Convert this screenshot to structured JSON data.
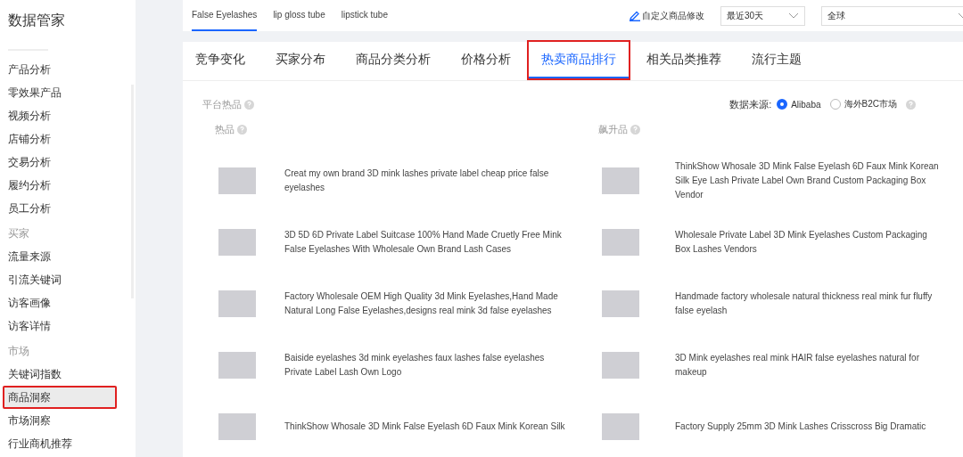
{
  "sidebar": {
    "title": "数据管家",
    "items": [
      {
        "label": "产品分析",
        "kind": "item",
        "selected": false,
        "annotated": false
      },
      {
        "label": "零效果产品",
        "kind": "item",
        "selected": false,
        "annotated": false
      },
      {
        "label": "视频分析",
        "kind": "item",
        "selected": false,
        "annotated": false
      },
      {
        "label": "店铺分析",
        "kind": "item",
        "selected": false,
        "annotated": false
      },
      {
        "label": "交易分析",
        "kind": "item",
        "selected": false,
        "annotated": false
      },
      {
        "label": "履约分析",
        "kind": "item",
        "selected": false,
        "annotated": false
      },
      {
        "label": "员工分析",
        "kind": "item",
        "selected": false,
        "annotated": false
      },
      {
        "label": "买家",
        "kind": "header"
      },
      {
        "label": "流量来源",
        "kind": "item",
        "selected": false,
        "annotated": false
      },
      {
        "label": "引流关键词",
        "kind": "item",
        "selected": false,
        "annotated": false
      },
      {
        "label": "访客画像",
        "kind": "item",
        "selected": false,
        "annotated": false
      },
      {
        "label": "访客详情",
        "kind": "item",
        "selected": false,
        "annotated": false
      },
      {
        "label": "市场",
        "kind": "header"
      },
      {
        "label": "关键词指数",
        "kind": "item",
        "selected": false,
        "annotated": false
      },
      {
        "label": "商品洞察",
        "kind": "item",
        "selected": true,
        "annotated": true
      },
      {
        "label": "市场洞察",
        "kind": "item",
        "selected": false,
        "annotated": false
      },
      {
        "label": "行业商机推荐",
        "kind": "item",
        "selected": false,
        "annotated": false
      }
    ]
  },
  "product_tabs": [
    {
      "label": "False Eyelashes",
      "selected": true
    },
    {
      "label": "lip gloss tube",
      "selected": false
    },
    {
      "label": "lipstick tube",
      "selected": false
    }
  ],
  "edit_link": "自定义商品修改",
  "period_select": {
    "value": "最近30天"
  },
  "region_select": {
    "value": "全球"
  },
  "tabs": [
    {
      "label": "竞争变化",
      "selected": false,
      "annotated": false
    },
    {
      "label": "买家分布",
      "selected": false,
      "annotated": false
    },
    {
      "label": "商品分类分析",
      "selected": false,
      "annotated": false
    },
    {
      "label": "价格分析",
      "selected": false,
      "annotated": false
    },
    {
      "label": "热卖商品排行",
      "selected": true,
      "annotated": true
    },
    {
      "label": "相关品类推荐",
      "selected": false,
      "annotated": false
    },
    {
      "label": "流行主题",
      "selected": false,
      "annotated": false
    }
  ],
  "section_title": "平台热品",
  "data_source": {
    "label": "数据来源:",
    "options": [
      {
        "label": "Alibaba",
        "selected": true
      },
      {
        "label": "海外B2C市场",
        "selected": false
      }
    ]
  },
  "columns": [
    {
      "title": "热品",
      "products": [
        "Creat my own brand 3D mink lashes private label cheap price false eyelashes",
        "3D 5D 6D Private Label Suitcase 100% Hand Made Cruetly Free Mink False Eyelashes With Wholesale Own Brand Lash Cases",
        "Factory Wholesale OEM High Quality 3d Mink Eyelashes,Hand Made Natural Long False Eyelashes,designs real mink 3d false eyelashes",
        "Baiside eyelashes 3d mink eyelashes faux lashes false eyelashes Private Label Lash Own Logo",
        "ThinkShow Whosale 3D Mink False Eyelash 6D Faux Mink Korean Silk"
      ]
    },
    {
      "title": "飙升品",
      "products": [
        "ThinkShow Whosale 3D Mink False Eyelash 6D Faux Mink Korean Silk Eye Lash Private Label Own Brand Custom Packaging Box Vendor",
        "Wholesale Private Label 3D Mink Eyelashes Custom Packaging Box Lashes Vendors",
        "Handmade factory wholesale natural thickness real mink fur fluffy false eyelash",
        "3D Mink eyelashes real mink HAIR false eyelashes natural for makeup",
        "Factory Supply 25mm 3D Mink Lashes Crisscross Big Dramatic"
      ]
    }
  ]
}
